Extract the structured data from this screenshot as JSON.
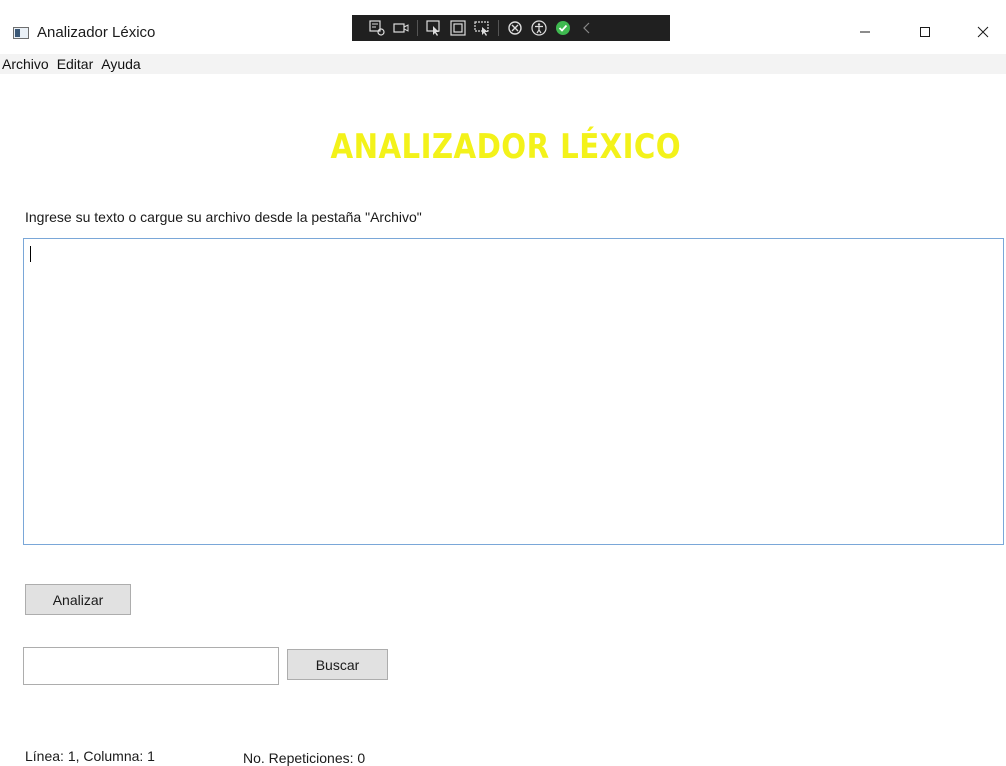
{
  "window": {
    "title": "Analizador Léxico",
    "minimize_icon": "minimize-icon",
    "maximize_icon": "maximize-icon",
    "close_icon": "close-icon"
  },
  "debug_toolbar": {
    "icons": [
      "live-visual-tree-icon",
      "record-icon",
      "select-element-icon",
      "display-layout-adorners-icon",
      "track-focus-icon",
      "hot-reload-icon",
      "accessibility-icon",
      "check-icon",
      "collapse-chevron-icon"
    ],
    "accent_color": "#3fb950"
  },
  "menu": {
    "items": [
      "Archivo",
      "Editar",
      "Ayuda"
    ]
  },
  "main": {
    "heading": "Analizador Léxico",
    "heading_color": "#f3f21a",
    "instruction": "Ingrese su texto o cargue su archivo desde la pestaña \"Archivo\"",
    "editor_value": "",
    "analyze_button": "Analizar",
    "search_value": "",
    "search_button": "Buscar"
  },
  "status": {
    "position": "Línea: 1, Columna: 1",
    "repetitions": "No. Repeticiones: 0"
  }
}
